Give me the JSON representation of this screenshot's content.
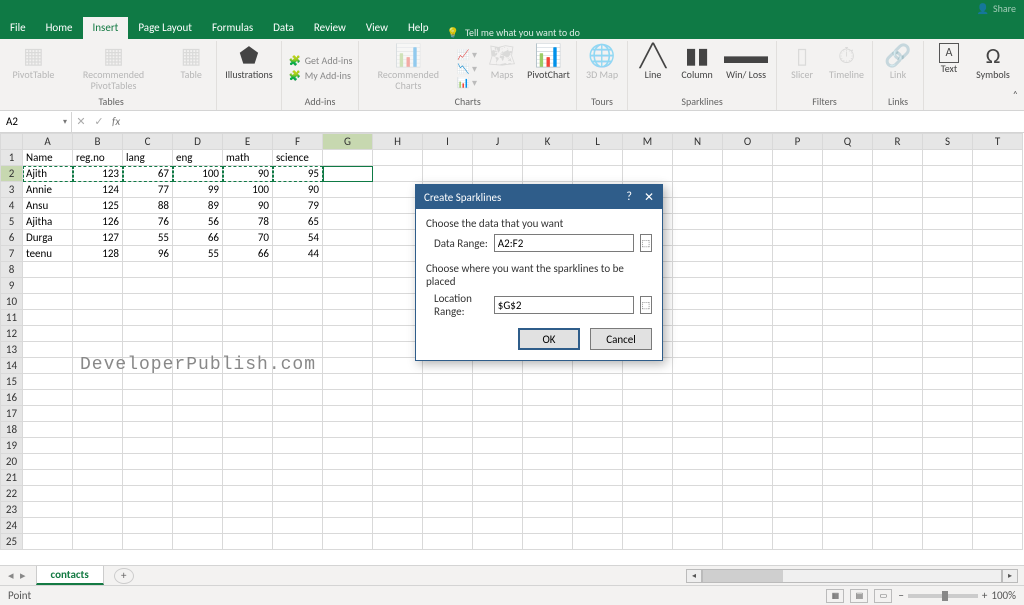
{
  "titlebar": {
    "share": "Share"
  },
  "menu": {
    "file": "File",
    "home": "Home",
    "insert": "Insert",
    "page_layout": "Page Layout",
    "formulas": "Formulas",
    "data": "Data",
    "review": "Review",
    "view": "View",
    "help": "Help",
    "tellme": "Tell me what you want to do"
  },
  "ribbon": {
    "tables": {
      "pivot": "PivotTable",
      "recommended": "Recommended PivotTables",
      "table": "Table",
      "group": "Tables"
    },
    "illus": {
      "label": "Illustrations"
    },
    "addins": {
      "get": "Get Add-ins",
      "my": "My Add-ins",
      "group": "Add-ins"
    },
    "charts": {
      "recommended": "Recommended Charts",
      "maps": "Maps",
      "pivotchart": "PivotChart",
      "group": "Charts"
    },
    "tours": {
      "map3d": "3D Map",
      "group": "Tours"
    },
    "sparklines": {
      "line": "Line",
      "column": "Column",
      "winloss": "Win/ Loss",
      "group": "Sparklines"
    },
    "filters": {
      "slicer": "Slicer",
      "timeline": "Timeline",
      "group": "Filters"
    },
    "links": {
      "link": "Link",
      "group": "Links"
    },
    "text": {
      "text": "Text",
      "symbols": "Symbols"
    }
  },
  "namebox": "A2",
  "columns": [
    "A",
    "B",
    "C",
    "D",
    "E",
    "F",
    "G",
    "H",
    "I",
    "J",
    "K",
    "L",
    "M",
    "N",
    "O",
    "P",
    "Q",
    "R",
    "S",
    "T"
  ],
  "headers": {
    "A": "Name",
    "B": "reg.no",
    "C": "lang",
    "D": "eng",
    "E": "math",
    "F": "science"
  },
  "rows": [
    {
      "A": "Ajith",
      "B": 123,
      "C": 67,
      "D": 100,
      "E": 90,
      "F": 95
    },
    {
      "A": "Annie",
      "B": 124,
      "C": 77,
      "D": 99,
      "E": 100,
      "F": 90
    },
    {
      "A": "Ansu",
      "B": 125,
      "C": 88,
      "D": 89,
      "E": 90,
      "F": 79
    },
    {
      "A": "Ajitha",
      "B": 126,
      "C": 76,
      "D": 56,
      "E": 78,
      "F": 65
    },
    {
      "A": "Durga",
      "B": 127,
      "C": 55,
      "D": 66,
      "E": 70,
      "F": 54
    },
    {
      "A": "teenu",
      "B": 128,
      "C": 96,
      "D": 55,
      "E": 66,
      "F": 44
    }
  ],
  "watermark": "DeveloperPublish.com",
  "dialog": {
    "title": "Create Sparklines",
    "choose_data": "Choose the data that you want",
    "data_range_label": "Data Range:",
    "data_range_value": "A2:F2",
    "choose_loc": "Choose where you want the sparklines to be placed",
    "loc_label": "Location Range:",
    "loc_value": "$G$2",
    "ok": "OK",
    "cancel": "Cancel"
  },
  "sheet": {
    "name": "contacts"
  },
  "status": {
    "mode": "Point",
    "zoom": "100%"
  }
}
